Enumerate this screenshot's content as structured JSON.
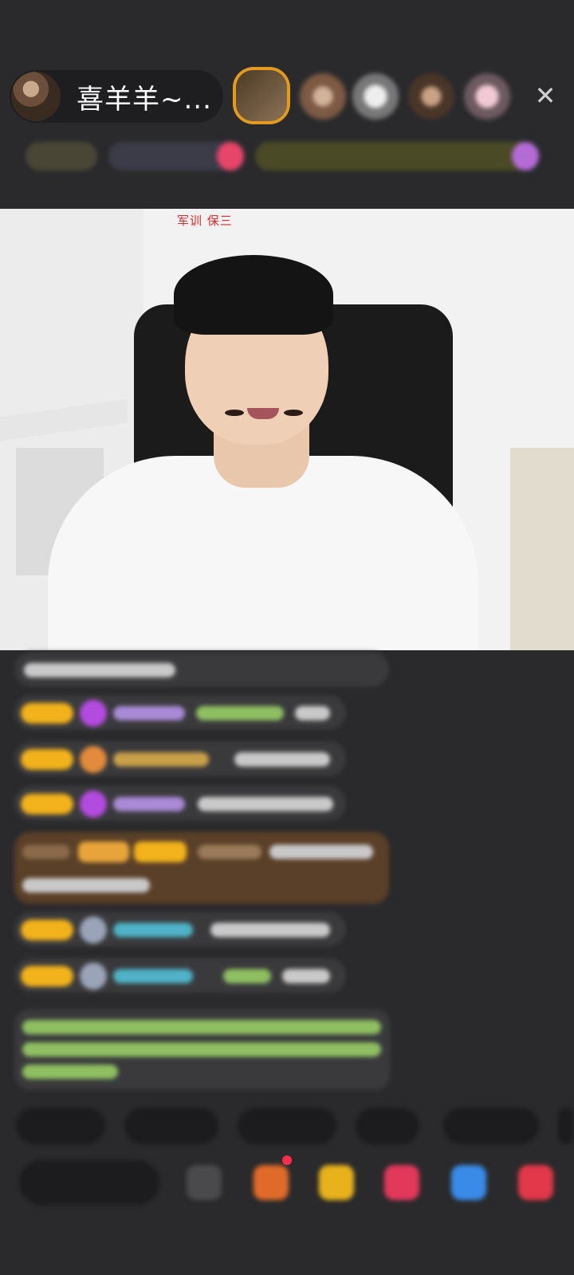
{
  "header": {
    "host_name": "喜羊羊~...",
    "close_icon": "close-icon"
  },
  "video": {
    "caption": "军训 保三"
  }
}
